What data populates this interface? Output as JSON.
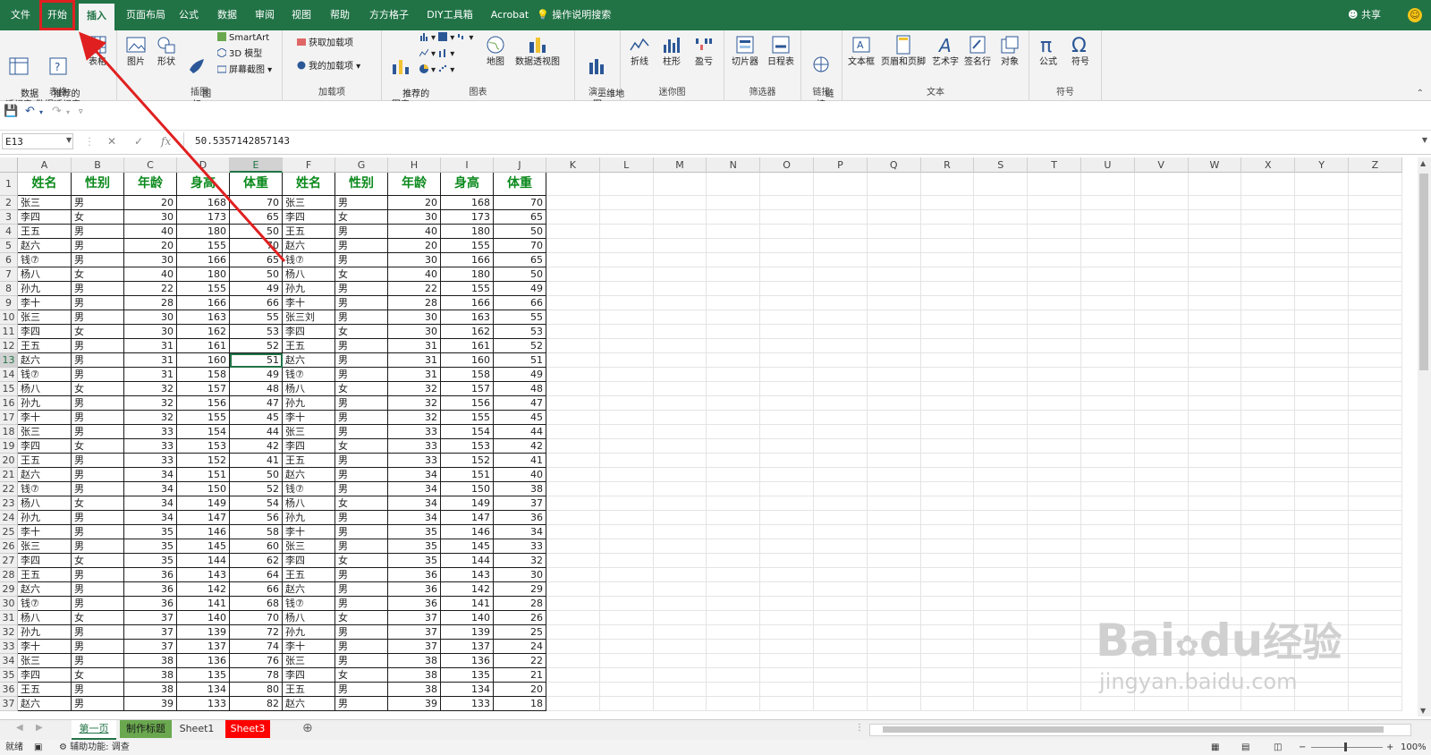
{
  "menu": {
    "tabs": [
      {
        "label": "文件",
        "state": ""
      },
      {
        "label": "开始",
        "state": "hl"
      },
      {
        "label": "插入",
        "state": "active"
      },
      {
        "label": "页面布局",
        "state": ""
      },
      {
        "label": "公式",
        "state": ""
      },
      {
        "label": "数据",
        "state": ""
      },
      {
        "label": "审阅",
        "state": ""
      },
      {
        "label": "视图",
        "state": ""
      },
      {
        "label": "帮助",
        "state": ""
      },
      {
        "label": "方方格子",
        "state": ""
      },
      {
        "label": "DIY工具箱",
        "state": ""
      },
      {
        "label": "Acrobat",
        "state": ""
      }
    ],
    "search_label": "操作说明搜索",
    "share_label": "共享",
    "accent": "#217346"
  },
  "ribbon": {
    "groups": {
      "tables": {
        "label": "表格",
        "pivot": "数据\n透视表",
        "recommended_pivot": "推荐的\n数据透视表",
        "table": "表格"
      },
      "illustrations": {
        "label": "插图",
        "picture": "图片",
        "shapes": "形状",
        "icons": "图\n标",
        "smartart": "SmartArt",
        "model3d": "3D 模型",
        "screenshot": "屏幕截图"
      },
      "addins": {
        "label": "加载项",
        "get": "获取加载项",
        "my": "我的加载项"
      },
      "charts": {
        "label": "图表",
        "recommended": "推荐的\n图表",
        "map": "地图",
        "pivot_chart": "数据透视图"
      },
      "tours": {
        "label": "演示",
        "map3d": "三维地\n图"
      },
      "sparklines": {
        "label": "迷你图",
        "line": "折线",
        "column": "柱形",
        "winloss": "盈亏"
      },
      "filters": {
        "label": "筛选器",
        "slicer": "切片器",
        "timeline": "日程表"
      },
      "links": {
        "label": "链接",
        "link": "链\n接"
      },
      "text": {
        "label": "文本",
        "textbox": "文本框",
        "header_footer": "页眉和页脚",
        "wordart": "艺术字",
        "signature": "签名行",
        "object": "对象"
      },
      "symbols": {
        "label": "符号",
        "equation": "公式",
        "symbol": "符号"
      }
    }
  },
  "formula_bar": {
    "name_box": "E13",
    "cancel_icon": "✕",
    "enter_icon": "✓",
    "fx_label": "fx",
    "value": "50.5357142857143"
  },
  "sheet": {
    "columns": [
      "A",
      "B",
      "C",
      "D",
      "E",
      "F",
      "G",
      "H",
      "I",
      "J",
      "K",
      "L",
      "M",
      "N",
      "O",
      "P",
      "Q",
      "R",
      "S",
      "T",
      "U",
      "V",
      "W",
      "X",
      "Y",
      "Z"
    ],
    "header_row": [
      "姓名",
      "性别",
      "年龄",
      "身高",
      "体重",
      "姓名",
      "性别",
      "年龄",
      "身高",
      "体重"
    ],
    "rows": [
      [
        "张三",
        "男",
        "20",
        "168",
        "70",
        "张三",
        "男",
        "20",
        "168",
        "70"
      ],
      [
        "李四",
        "女",
        "30",
        "173",
        "65",
        "李四",
        "女",
        "30",
        "173",
        "65"
      ],
      [
        "王五",
        "男",
        "40",
        "180",
        "50",
        "王五",
        "男",
        "40",
        "180",
        "50"
      ],
      [
        "赵六",
        "男",
        "20",
        "155",
        "70",
        "赵六",
        "男",
        "20",
        "155",
        "70"
      ],
      [
        "钱⑦",
        "男",
        "30",
        "166",
        "65",
        "钱⑦",
        "男",
        "30",
        "166",
        "65"
      ],
      [
        "杨八",
        "女",
        "40",
        "180",
        "50",
        "杨八",
        "女",
        "40",
        "180",
        "50"
      ],
      [
        "孙九",
        "男",
        "22",
        "155",
        "49",
        "孙九",
        "男",
        "22",
        "155",
        "49"
      ],
      [
        "李十",
        "男",
        "28",
        "166",
        "66",
        "李十",
        "男",
        "28",
        "166",
        "66"
      ],
      [
        "张三",
        "男",
        "30",
        "163",
        "55",
        "张三刘",
        "男",
        "30",
        "163",
        "55"
      ],
      [
        "李四",
        "女",
        "30",
        "162",
        "53",
        "李四",
        "女",
        "30",
        "162",
        "53"
      ],
      [
        "王五",
        "男",
        "31",
        "161",
        "52",
        "王五",
        "男",
        "31",
        "161",
        "52"
      ],
      [
        "赵六",
        "男",
        "31",
        "160",
        "51",
        "赵六",
        "男",
        "31",
        "160",
        "51"
      ],
      [
        "钱⑦",
        "男",
        "31",
        "158",
        "49",
        "钱⑦",
        "男",
        "31",
        "158",
        "49"
      ],
      [
        "杨八",
        "女",
        "32",
        "157",
        "48",
        "杨八",
        "女",
        "32",
        "157",
        "48"
      ],
      [
        "孙九",
        "男",
        "32",
        "156",
        "47",
        "孙九",
        "男",
        "32",
        "156",
        "47"
      ],
      [
        "李十",
        "男",
        "32",
        "155",
        "45",
        "李十",
        "男",
        "32",
        "155",
        "45"
      ],
      [
        "张三",
        "男",
        "33",
        "154",
        "44",
        "张三",
        "男",
        "33",
        "154",
        "44"
      ],
      [
        "李四",
        "女",
        "33",
        "153",
        "42",
        "李四",
        "女",
        "33",
        "153",
        "42"
      ],
      [
        "王五",
        "男",
        "33",
        "152",
        "41",
        "王五",
        "男",
        "33",
        "152",
        "41"
      ],
      [
        "赵六",
        "男",
        "34",
        "151",
        "50",
        "赵六",
        "男",
        "34",
        "151",
        "40"
      ],
      [
        "钱⑦",
        "男",
        "34",
        "150",
        "52",
        "钱⑦",
        "男",
        "34",
        "150",
        "38"
      ],
      [
        "杨八",
        "女",
        "34",
        "149",
        "54",
        "杨八",
        "女",
        "34",
        "149",
        "37"
      ],
      [
        "孙九",
        "男",
        "34",
        "147",
        "56",
        "孙九",
        "男",
        "34",
        "147",
        "36"
      ],
      [
        "李十",
        "男",
        "35",
        "146",
        "58",
        "李十",
        "男",
        "35",
        "146",
        "34"
      ],
      [
        "张三",
        "男",
        "35",
        "145",
        "60",
        "张三",
        "男",
        "35",
        "145",
        "33"
      ],
      [
        "李四",
        "女",
        "35",
        "144",
        "62",
        "李四",
        "女",
        "35",
        "144",
        "32"
      ],
      [
        "王五",
        "男",
        "36",
        "143",
        "64",
        "王五",
        "男",
        "36",
        "143",
        "30"
      ],
      [
        "赵六",
        "男",
        "36",
        "142",
        "66",
        "赵六",
        "男",
        "36",
        "142",
        "29"
      ],
      [
        "钱⑦",
        "男",
        "36",
        "141",
        "68",
        "钱⑦",
        "男",
        "36",
        "141",
        "28"
      ],
      [
        "杨八",
        "女",
        "37",
        "140",
        "70",
        "杨八",
        "女",
        "37",
        "140",
        "26"
      ],
      [
        "孙九",
        "男",
        "37",
        "139",
        "72",
        "孙九",
        "男",
        "37",
        "139",
        "25"
      ],
      [
        "李十",
        "男",
        "37",
        "137",
        "74",
        "李十",
        "男",
        "37",
        "137",
        "24"
      ],
      [
        "张三",
        "男",
        "38",
        "136",
        "76",
        "张三",
        "男",
        "38",
        "136",
        "22"
      ],
      [
        "李四",
        "女",
        "38",
        "135",
        "78",
        "李四",
        "女",
        "38",
        "135",
        "21"
      ],
      [
        "王五",
        "男",
        "38",
        "134",
        "80",
        "王五",
        "男",
        "38",
        "134",
        "20"
      ],
      [
        "赵六",
        "男",
        "39",
        "133",
        "82",
        "赵六",
        "男",
        "39",
        "133",
        "18"
      ]
    ],
    "active_cell": {
      "row": 13,
      "col": "E"
    },
    "header_color": "#0c8a1d"
  },
  "sheet_tabs": [
    {
      "label": "第一页",
      "style": "green-active"
    },
    {
      "label": "制作标题",
      "style": "green"
    },
    {
      "label": "Sheet1",
      "style": "plain"
    },
    {
      "label": "Sheet3",
      "style": "red"
    }
  ],
  "status": {
    "ready": "就绪",
    "accessibility": "辅助功能: 调查",
    "zoom": "100%"
  },
  "watermark": {
    "brand": "Bai",
    "paw": "du",
    "suffix": "经验",
    "url": "jingyan.baidu.com"
  }
}
